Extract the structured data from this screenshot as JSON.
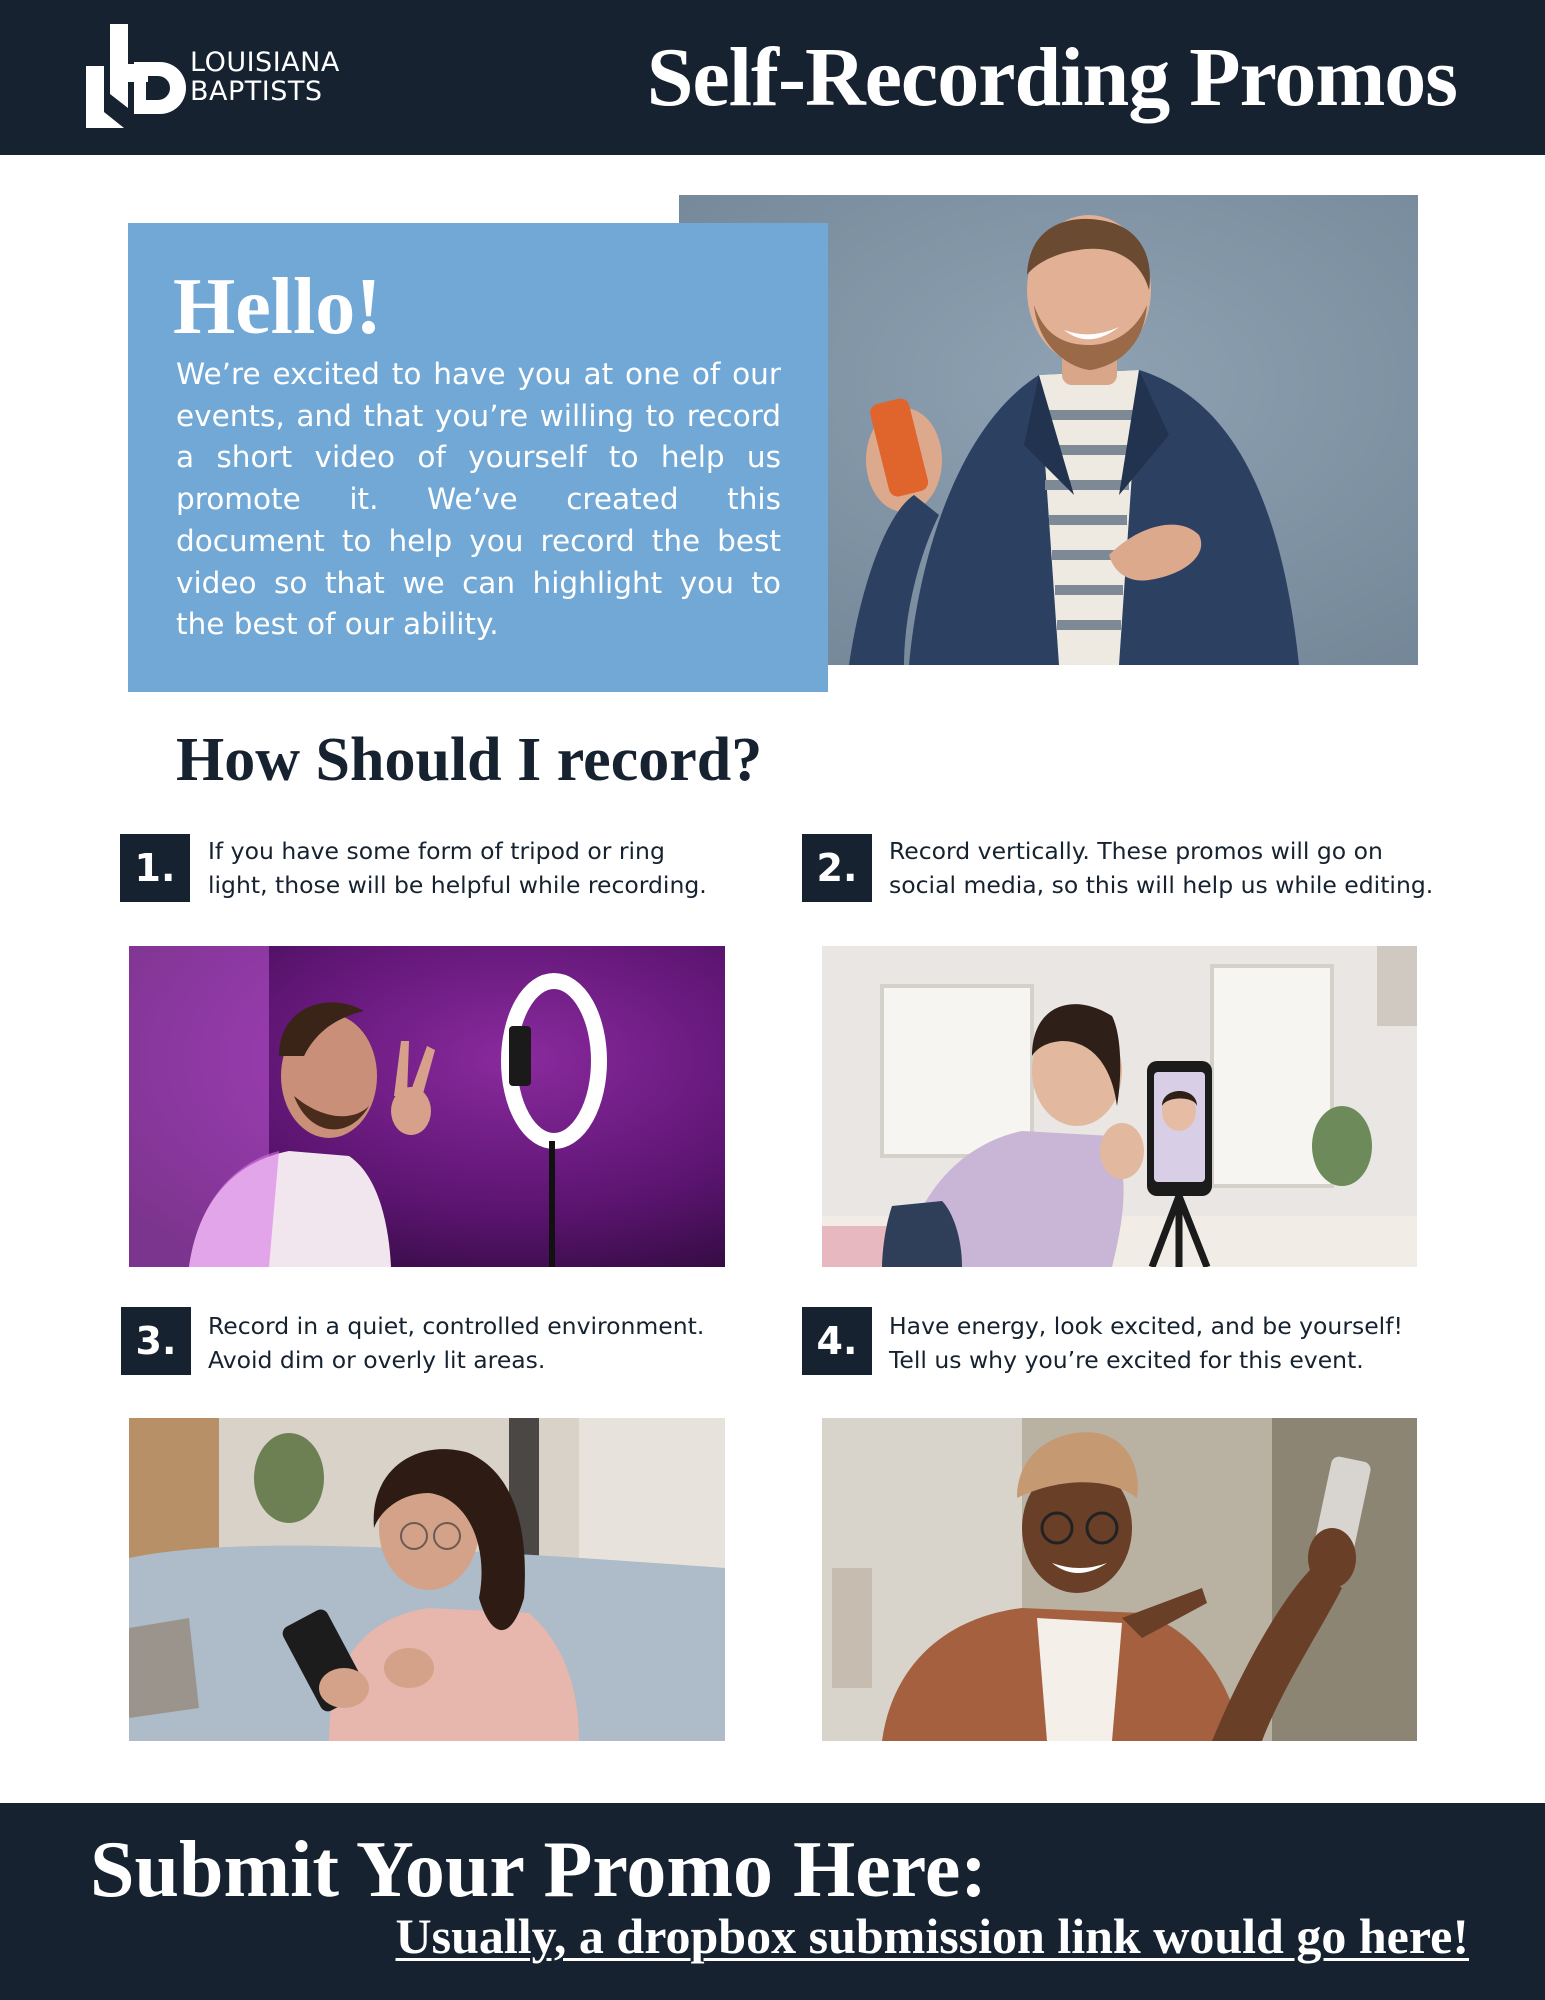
{
  "header": {
    "logo_line1": "LOUISIANA",
    "logo_line2": "BAPTISTS",
    "title": "Self-Recording Promos"
  },
  "intro": {
    "heading": "Hello!",
    "body": "We’re excited to have you at one of our events, and that you’re willing to record a short video of yourself to help us promote it. We’ve created this document to help you record the best video so that we can highlight you to the best of our ability."
  },
  "section_title": "How Should I record?",
  "steps": [
    {
      "number": "1.",
      "line1": "If you have some form of tripod or ring",
      "line2": "light, those will be helpful while recording."
    },
    {
      "number": "2.",
      "line1": "Record vertically. These promos will go on",
      "line2": "social media, so this will help us while editing."
    },
    {
      "number": "3.",
      "line1": "Record in a quiet, controlled environment.",
      "line2": "Avoid dim or overly lit areas."
    },
    {
      "number": "4.",
      "line1": "Have energy, look excited, and be yourself!",
      "line2": "Tell us why you’re excited for this event."
    }
  ],
  "footer": {
    "title": "Submit Your Promo Here:",
    "link_text": "Usually, a dropbox submission link would go here!"
  },
  "colors": {
    "navy": "#16222f",
    "hello_blue": "#72a8d6",
    "hero_bg": "#7f93a6",
    "white": "#ffffff"
  }
}
